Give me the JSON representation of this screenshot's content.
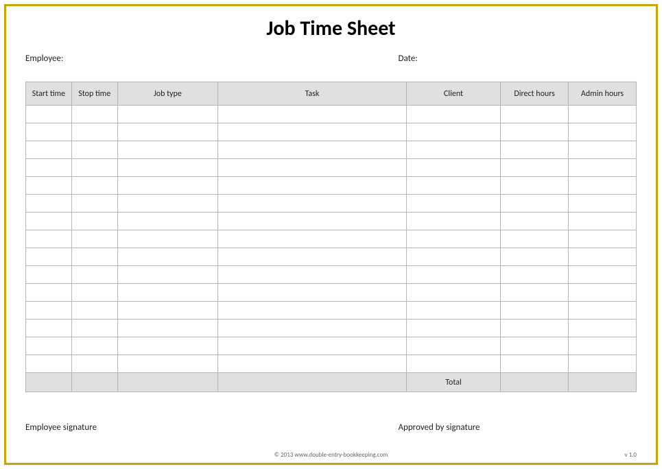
{
  "title": "Job Time Sheet",
  "labels": {
    "employee": "Employee:",
    "date": "Date:"
  },
  "columns": {
    "start": "Start time",
    "stop": "Stop time",
    "job": "Job type",
    "task": "Task",
    "client": "Client",
    "direct": "Direct hours",
    "admin": "Admin hours"
  },
  "total_label": "Total",
  "signatures": {
    "employee": "Employee signature",
    "approved": "Approved by signature"
  },
  "footer": {
    "copyright": "© 2013 www.double-entry-bookkeeping.com",
    "version": "v 1.0"
  },
  "row_count": 15
}
